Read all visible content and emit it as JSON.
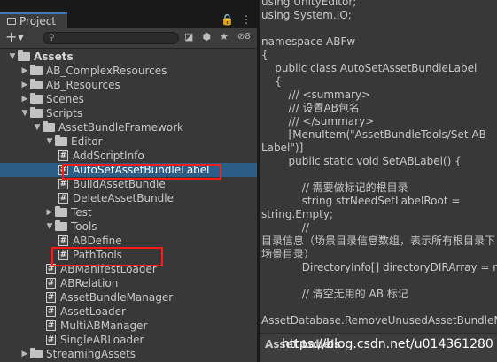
{
  "project_panel": {
    "tab_label": "Project",
    "tab_icons": [
      "🔒",
      "⋮"
    ],
    "toolbar": {
      "create_label": "+",
      "search_placeholder": "",
      "hidden_count": "8"
    },
    "tree": [
      {
        "label": "Assets",
        "depth": 0,
        "type": "folder",
        "expanded": true,
        "bold": true
      },
      {
        "label": "AB_ComplexResources",
        "depth": 1,
        "type": "folder",
        "expanded": false
      },
      {
        "label": "AB_Resources",
        "depth": 1,
        "type": "folder",
        "expanded": false
      },
      {
        "label": "Scenes",
        "depth": 1,
        "type": "folder",
        "expanded": false
      },
      {
        "label": "Scripts",
        "depth": 1,
        "type": "folder",
        "expanded": true
      },
      {
        "label": "AssetBundleFramework",
        "depth": 2,
        "type": "folder",
        "expanded": true
      },
      {
        "label": "Editor",
        "depth": 3,
        "type": "folder",
        "expanded": true
      },
      {
        "label": "AddScriptInfo",
        "depth": 4,
        "type": "script"
      },
      {
        "label": "AutoSetAssetBundleLabel",
        "depth": 4,
        "type": "script",
        "selected": true,
        "highlighted": true
      },
      {
        "label": "BuildAssetBundle",
        "depth": 4,
        "type": "script"
      },
      {
        "label": "DeleteAssetBundle",
        "depth": 4,
        "type": "script"
      },
      {
        "label": "Test",
        "depth": 3,
        "type": "folder",
        "expanded": false
      },
      {
        "label": "Tools",
        "depth": 3,
        "type": "folder",
        "expanded": true
      },
      {
        "label": "ABDefine",
        "depth": 4,
        "type": "script"
      },
      {
        "label": "PathTools",
        "depth": 4,
        "type": "script",
        "highlighted": true
      },
      {
        "label": "ABManifestLoader",
        "depth": 3,
        "type": "script"
      },
      {
        "label": "ABRelation",
        "depth": 3,
        "type": "script"
      },
      {
        "label": "AssetBundleManager",
        "depth": 3,
        "type": "script"
      },
      {
        "label": "AssetLoader",
        "depth": 3,
        "type": "script"
      },
      {
        "label": "MultiABManager",
        "depth": 3,
        "type": "script"
      },
      {
        "label": "SingleABLoader",
        "depth": 3,
        "type": "script"
      },
      {
        "label": "StreamingAssets",
        "depth": 1,
        "type": "folder",
        "expanded": false
      }
    ]
  },
  "code_panel": {
    "lines": [
      "using UnityEditor;",
      "using System.IO;",
      "",
      "namespace ABFw",
      "{",
      "    public class AutoSetAssetBundleLabel",
      "    {",
      "        /// <summary>",
      "        /// 设置AB包名",
      "        /// </summary>",
      "        [MenuItem(\"AssetBundleTools/Set AB",
      "Label\")]",
      "        public static void SetABLabel() {",
      "",
      "            // 需要做标记的根目录",
      "            string strNeedSetLabelRoot =",
      "string.Empty;",
      "            //",
      "目录信息（场景目录信息数组，表示所有根目录下",
      "场景目录）",
      "            DirectoryInfo[] directoryDIRArray = null;",
      "",
      "            // 清空无用的 AB 标记",
      "",
      "AssetDatabase.RemoveUnusedAssetBundleNames();"
    ],
    "asset_labels_header": "Asset Labels"
  },
  "watermark": "https://blog.csdn.net/u014361280",
  "colors": {
    "selection": "#2c5d87",
    "highlight_box": "#ff1a1a",
    "panel_bg": "#383838",
    "tab_accent": "#3a79bb"
  }
}
